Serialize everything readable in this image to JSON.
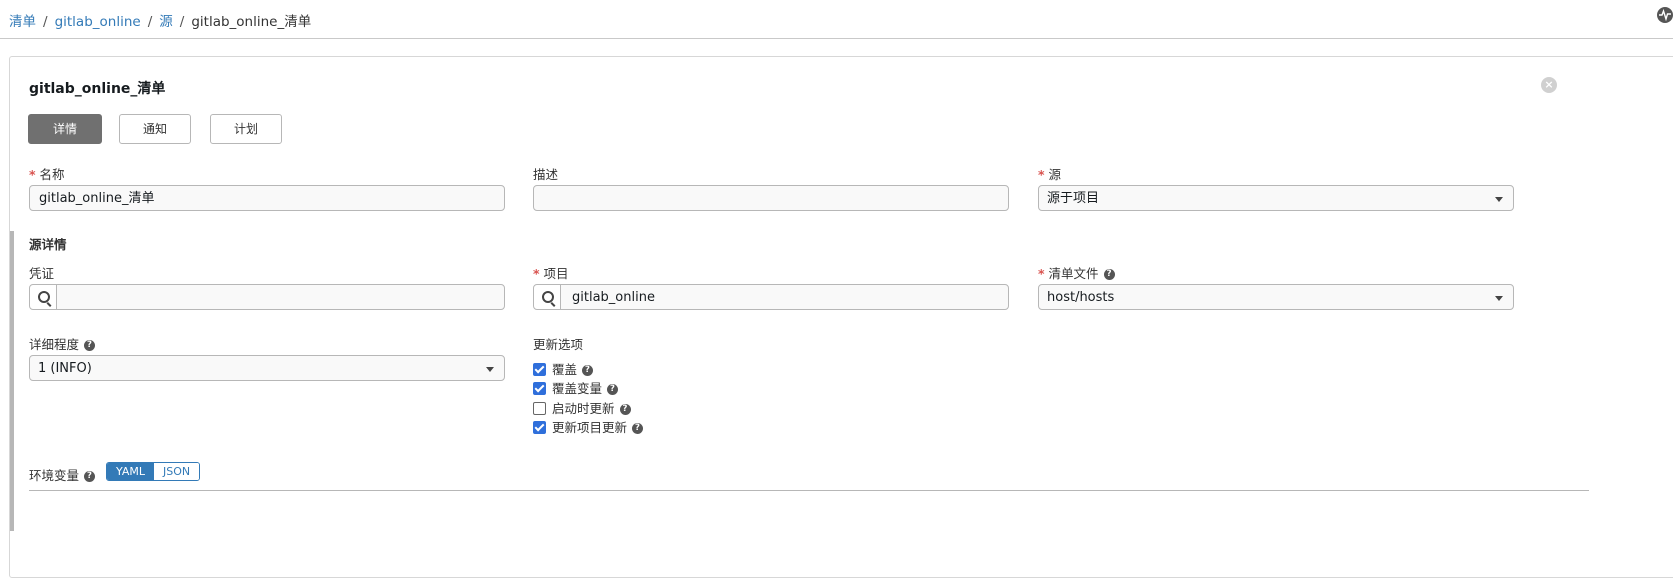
{
  "breadcrumb": {
    "items": [
      "清单",
      "gitlab_online",
      "源"
    ],
    "current": "gitlab_online_清单"
  },
  "panel": {
    "title": "gitlab_online_清单",
    "close_icon": "×"
  },
  "tabs": [
    {
      "label": "详情",
      "active": true
    },
    {
      "label": "通知",
      "active": false
    },
    {
      "label": "计划",
      "active": false
    }
  ],
  "form": {
    "name": {
      "label": "名称",
      "value": "gitlab_online_清单"
    },
    "description": {
      "label": "描述",
      "value": ""
    },
    "source": {
      "label": "源",
      "value": "源于项目"
    },
    "source_details_heading": "源详情",
    "credential": {
      "label": "凭证",
      "value": ""
    },
    "project": {
      "label": "项目",
      "value": "gitlab_online"
    },
    "inventory_file": {
      "label": "清单文件",
      "value": "host/hosts"
    },
    "verbosity": {
      "label": "详细程度",
      "value": "1 (INFO)"
    },
    "update_options": {
      "label": "更新选项",
      "options": [
        {
          "label": "覆盖",
          "checked": true
        },
        {
          "label": "覆盖变量",
          "checked": true
        },
        {
          "label": "启动时更新",
          "checked": false
        },
        {
          "label": "更新项目更新",
          "checked": true
        }
      ]
    },
    "env_vars": {
      "label": "环境变量",
      "modes": [
        "YAML",
        "JSON"
      ],
      "selected": "YAML"
    }
  },
  "icons": {
    "help": "?",
    "search": "search-icon",
    "activity": "activity-stream-icon"
  },
  "colors": {
    "link": "#337ab7",
    "required": "#d9534f",
    "active_tab": "#707070",
    "checkbox": "#2f6fdb"
  }
}
